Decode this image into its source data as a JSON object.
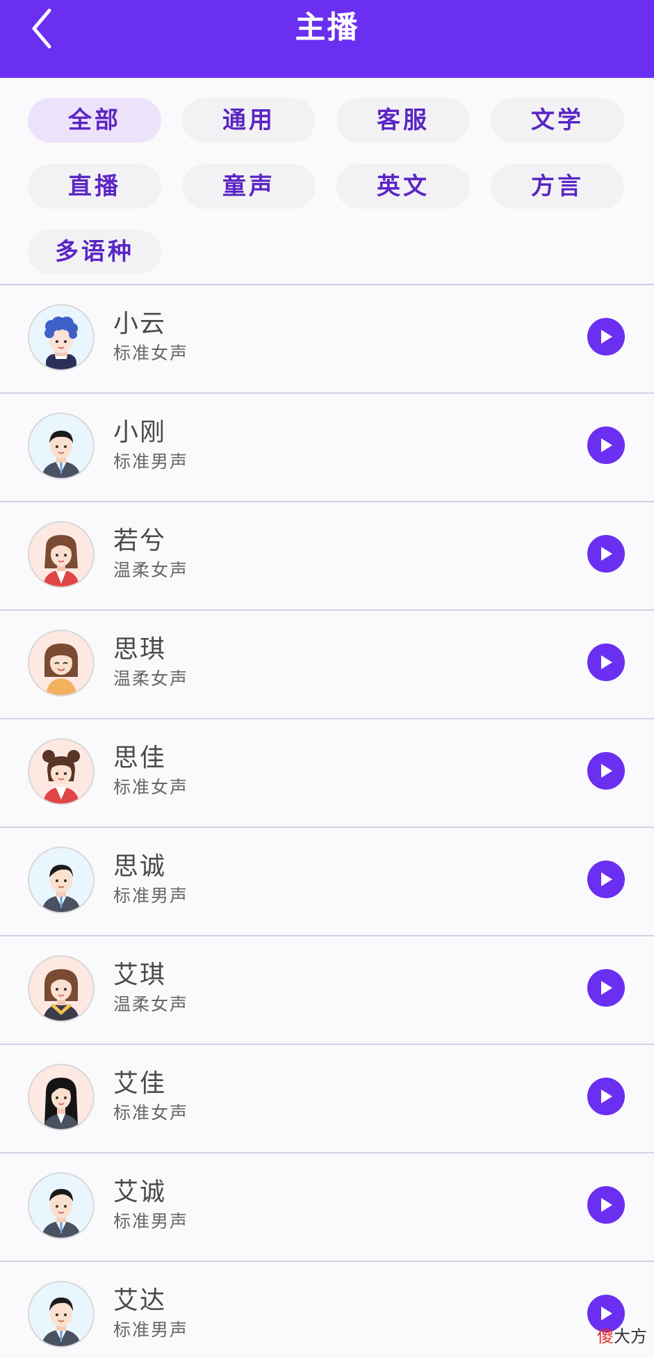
{
  "header": {
    "title": "主播",
    "back_icon": "chevron-left-icon"
  },
  "colors": {
    "header_bg": "#6a2ff0",
    "accent": "#6a2ff0",
    "chip_text": "#5b26c4",
    "chip_active_bg": "#ece3fb",
    "chip_bg": "#f2f2f5"
  },
  "filters": {
    "selected": "全部",
    "chips": [
      "全部",
      "通用",
      "客服",
      "文学",
      "直播",
      "童声",
      "英文",
      "方言",
      "多语种"
    ]
  },
  "speakers": [
    {
      "name": "小云",
      "voice": "标准女声",
      "avatar": "boy-curly-hair-avatar"
    },
    {
      "name": "小刚",
      "voice": "标准男声",
      "avatar": "man-suit-avatar"
    },
    {
      "name": "若兮",
      "voice": "温柔女声",
      "avatar": "woman-red-scarf-avatar"
    },
    {
      "name": "思琪",
      "voice": "温柔女声",
      "avatar": "smiling-girl-avatar"
    },
    {
      "name": "思佳",
      "voice": "标准女声",
      "avatar": "girl-buns-avatar"
    },
    {
      "name": "思诚",
      "voice": "标准男声",
      "avatar": "man-suit-avatar"
    },
    {
      "name": "艾琪",
      "voice": "温柔女声",
      "avatar": "woman-yellow-collar-avatar"
    },
    {
      "name": "艾佳",
      "voice": "标准女声",
      "avatar": "woman-long-black-hair-avatar"
    },
    {
      "name": "艾诚",
      "voice": "标准男声",
      "avatar": "man-suit-avatar"
    },
    {
      "name": "艾达",
      "voice": "标准男声",
      "avatar": "man-suit-avatar"
    }
  ],
  "play_icon": "play-icon",
  "watermark": {
    "accent": "傻",
    "rest": "大方"
  }
}
